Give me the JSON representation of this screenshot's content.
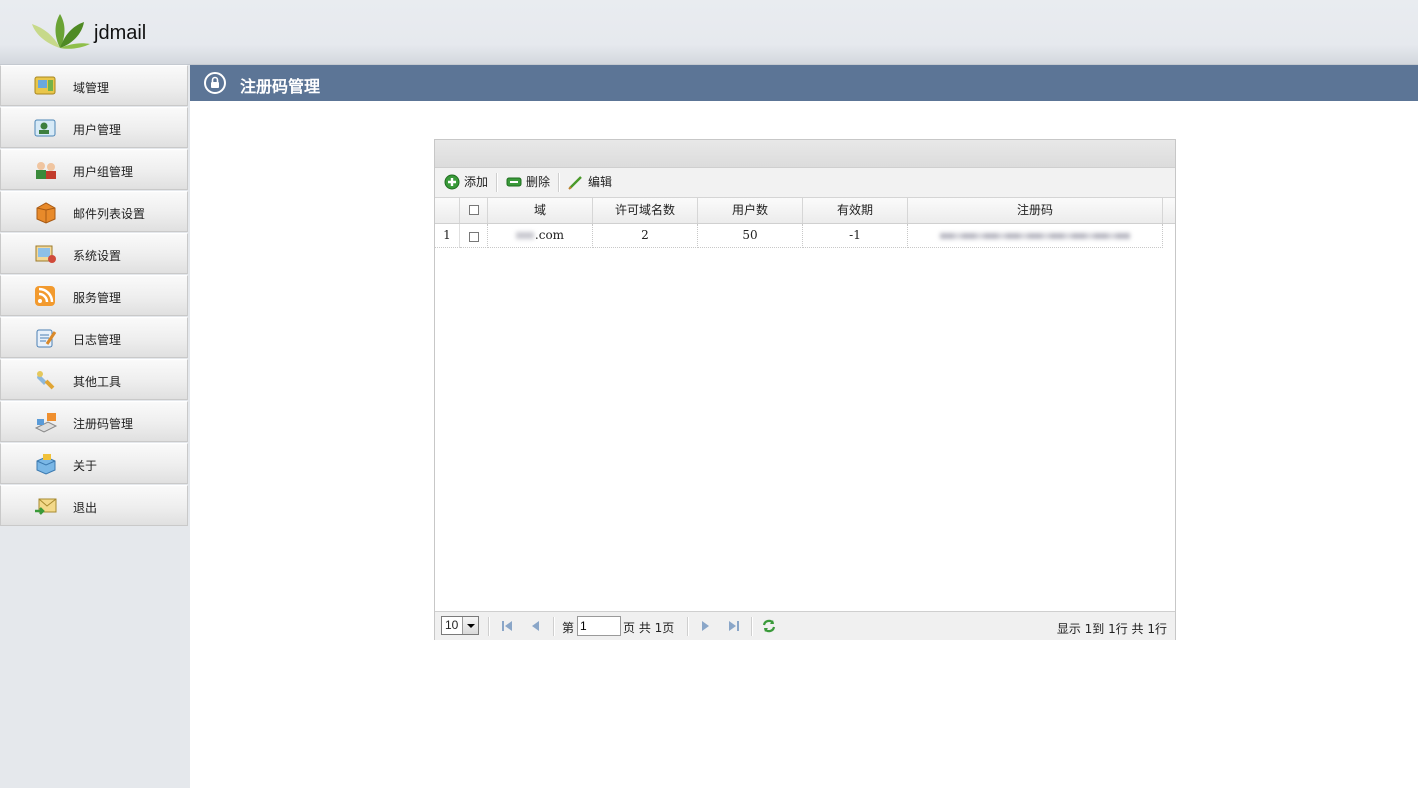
{
  "app": {
    "logo_text": "jdmail"
  },
  "sidebar": {
    "items": [
      {
        "label": "域管理",
        "icon": "domain-icon"
      },
      {
        "label": "用户管理",
        "icon": "user-icon"
      },
      {
        "label": "用户组管理",
        "icon": "group-icon"
      },
      {
        "label": "邮件列表设置",
        "icon": "mailing-list-icon"
      },
      {
        "label": "系统设置",
        "icon": "system-settings-icon"
      },
      {
        "label": "服务管理",
        "icon": "service-icon"
      },
      {
        "label": "日志管理",
        "icon": "log-icon"
      },
      {
        "label": "其他工具",
        "icon": "tools-icon"
      },
      {
        "label": "注册码管理",
        "icon": "license-icon"
      },
      {
        "label": "关于",
        "icon": "about-icon"
      },
      {
        "label": "退出",
        "icon": "logout-icon"
      }
    ]
  },
  "page": {
    "title": "注册码管理"
  },
  "toolbar": {
    "add": "添加",
    "delete": "删除",
    "edit": "编辑"
  },
  "table": {
    "columns": [
      "域",
      "许可域名数",
      "用户数",
      "有效期",
      "注册码"
    ],
    "rows": [
      {
        "index": "1",
        "domain_suffix": ".com",
        "license_domains": "2",
        "users": "50",
        "validity": "-1"
      }
    ]
  },
  "pager": {
    "page_size": "10",
    "page_prefix": "第",
    "current_page": "1",
    "page_total_text": "页 共 1页",
    "info": "显示 1到 1行 共 1行"
  }
}
